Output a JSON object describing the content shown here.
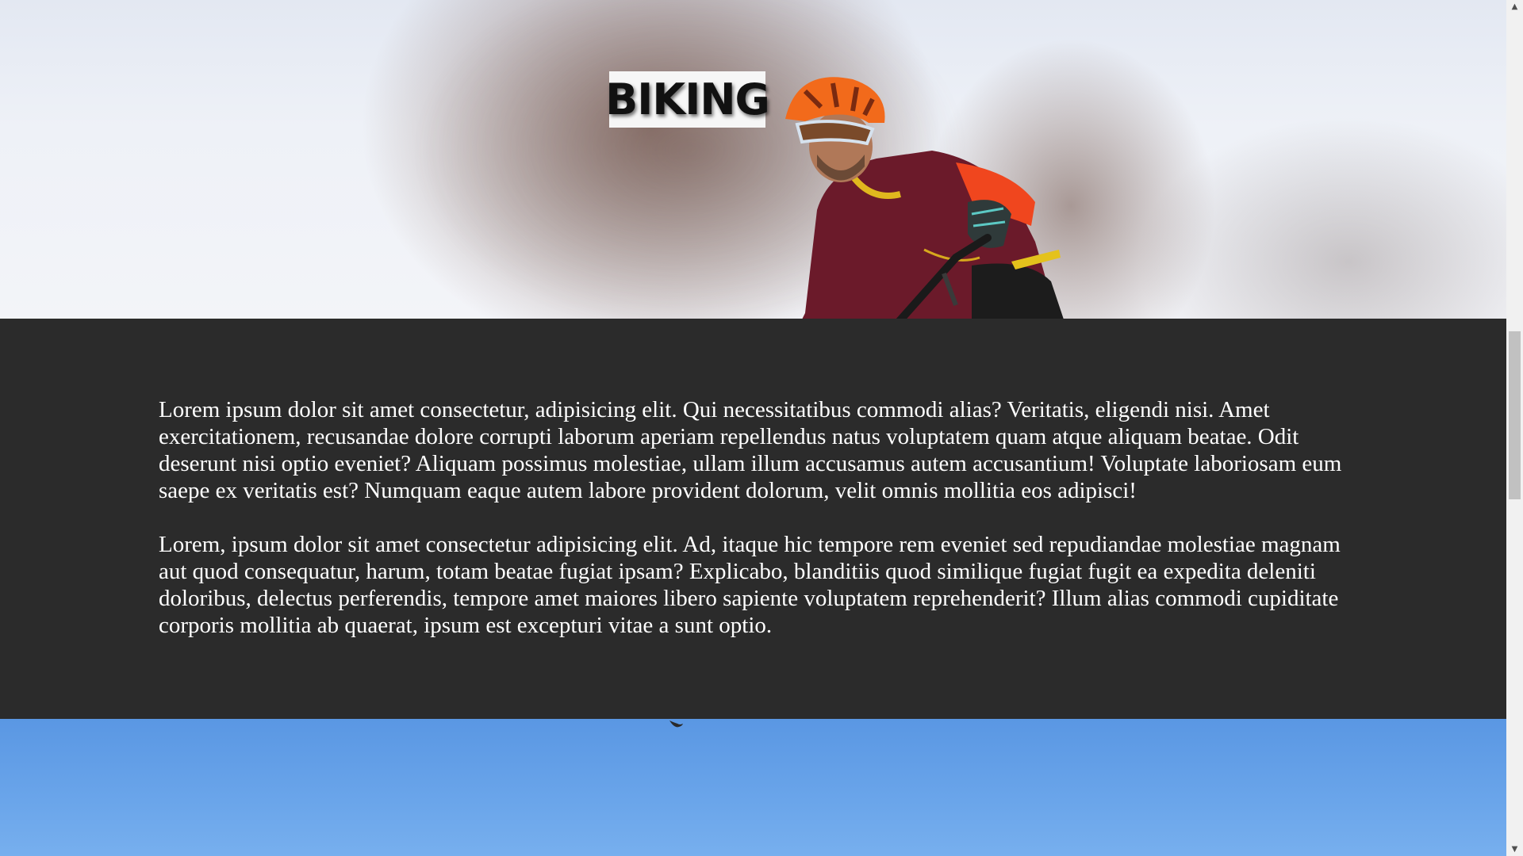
{
  "hero": {
    "title": "BIKING"
  },
  "content": {
    "paragraphs": [
      "Lorem ipsum dolor sit amet consectetur, adipisicing elit. Qui necessitatibus commodi alias? Veritatis, eligendi nisi. Amet exercitationem, recusandae dolore corrupti laborum aperiam repellendus natus voluptatem quam atque aliquam beatae. Odit deserunt nisi optio eveniet? Aliquam possimus molestiae, ullam illum accusamus autem accusantium! Voluptate laboriosam eum saepe ex veritatis est? Numquam eaque autem labore provident dolorum, velit omnis mollitia eos adipisci!",
      "Lorem, ipsum dolor sit amet consectetur adipisicing elit. Ad, itaque hic tempore rem eveniet sed repudiandae molestiae magnam aut quod consequatur, harum, totam beatae fugiat ipsam? Explicabo, blanditiis quod similique fugiat fugit ea expedita deleniti doloribus, delectus perferendis, tempore amet maiores libero sapiente voluptatem reprehenderit? Illum alias commodi cupiditate corporis mollitia ab quaerat, ipsum est excepturi vitae a sunt optio."
    ]
  },
  "scrollbar": {
    "up_icon": "triangle-up",
    "down_icon": "triangle-down",
    "up_glyph": "▲",
    "down_glyph": "▼"
  },
  "colors": {
    "content_background": "#2b2b2b",
    "title_background": "#f6f6f6",
    "sky_blue": "#5a97e3"
  }
}
